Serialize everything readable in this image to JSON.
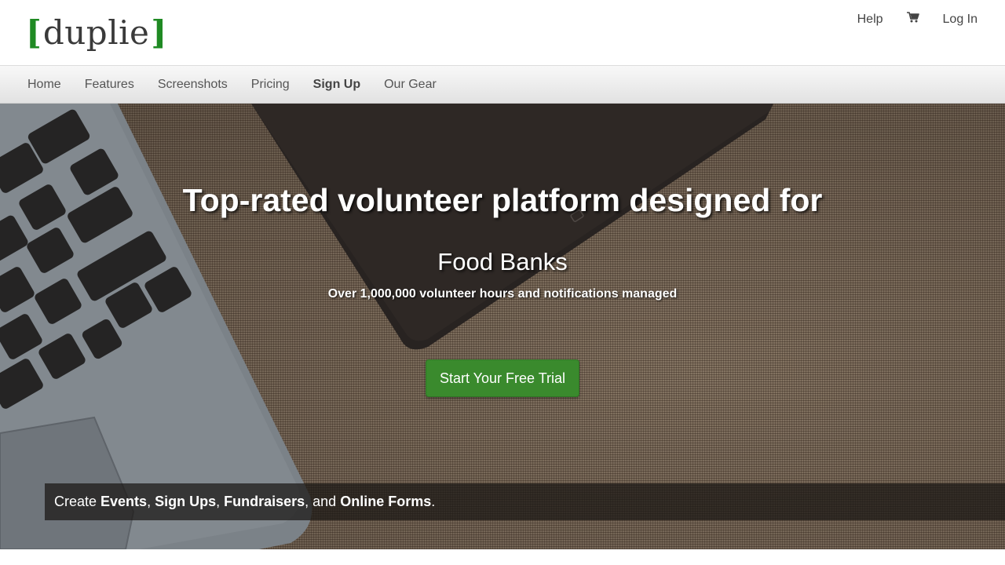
{
  "brand": {
    "open": "[",
    "name": "duplie",
    "close": "]",
    "accent": "#1f8a23"
  },
  "utility_nav": {
    "help": "Help",
    "cart_icon": "cart-icon",
    "login": "Log In"
  },
  "main_nav": [
    {
      "label": "Home"
    },
    {
      "label": "Features"
    },
    {
      "label": "Screenshots"
    },
    {
      "label": "Pricing"
    },
    {
      "label": "Sign Up"
    },
    {
      "label": "Our Gear"
    }
  ],
  "hero": {
    "title": "Top-rated volunteer platform designed for",
    "subtitle": "Food Banks",
    "stat": "Over 1,000,000 volunteer hours and notifications managed",
    "cta": "Start Your Free Trial",
    "cta_color": "#3a8a2d"
  },
  "features_bar": {
    "prefix": "Create ",
    "item1": "Events",
    "sep1": ", ",
    "item2": "Sign Ups",
    "sep2": ", ",
    "item3": "Fundraisers",
    "sep3": ", and ",
    "item4": "Online Forms",
    "suffix": "."
  }
}
